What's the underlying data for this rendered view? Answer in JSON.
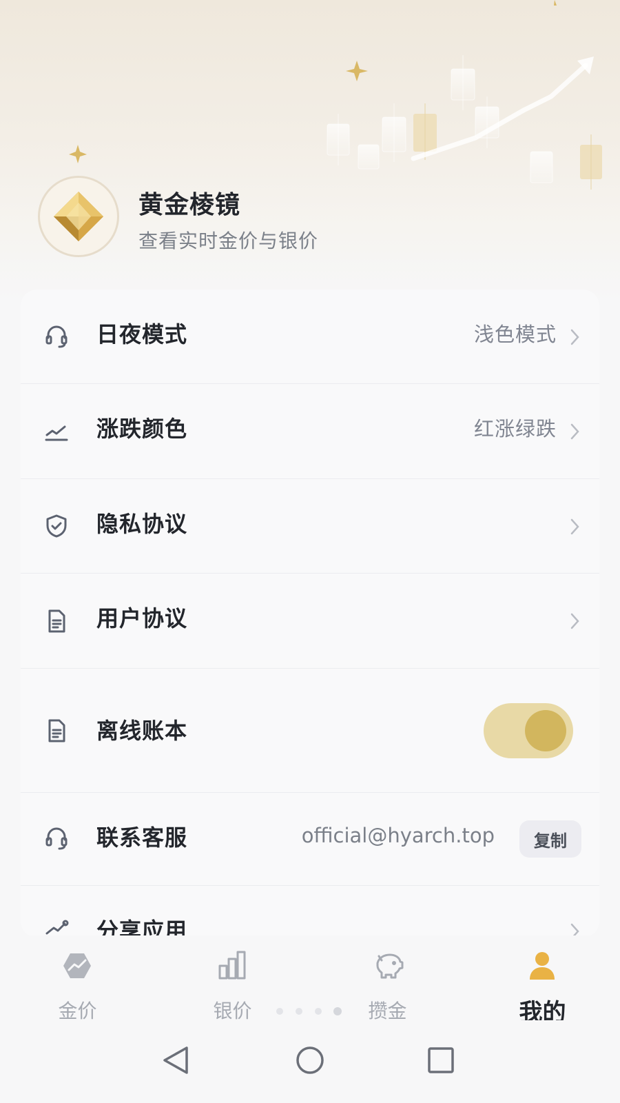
{
  "app": {
    "title": "黄金棱镜",
    "subtitle": "查看实时金价与银价"
  },
  "settings": [
    {
      "label": "日夜模式",
      "value": "浅色模式",
      "icon": "headset-icon"
    },
    {
      "label": "涨跌颜色",
      "value": "红涨绿跌",
      "icon": "trend-icon"
    },
    {
      "label": "隐私协议",
      "value": "",
      "icon": "shield-icon"
    },
    {
      "label": "用户协议",
      "value": "",
      "icon": "document-icon"
    },
    {
      "label": "离线账本",
      "toggle_on": true,
      "icon": "document-icon"
    },
    {
      "label": "联系客服",
      "email": "official@hyarch.top",
      "copy_label": "复制",
      "icon": "headset-icon"
    },
    {
      "label": "分享应用",
      "icon": "share-icon"
    }
  ],
  "tabs": [
    {
      "label": "金价",
      "icon": "gold-price-icon",
      "active": false
    },
    {
      "label": "银价",
      "icon": "bar-chart-icon",
      "active": false
    },
    {
      "label": "攒金",
      "icon": "piggy-bank-icon",
      "active": false
    },
    {
      "label": "我的",
      "icon": "user-icon",
      "active": true
    }
  ],
  "colors": {
    "accent_gold": "#d2b65e",
    "toggle_track": "#e8d9a6",
    "text_primary": "#23262c",
    "text_secondary": "#808591",
    "tab_inactive": "#a6aab2",
    "active_tab_icon": "#e9b245"
  }
}
